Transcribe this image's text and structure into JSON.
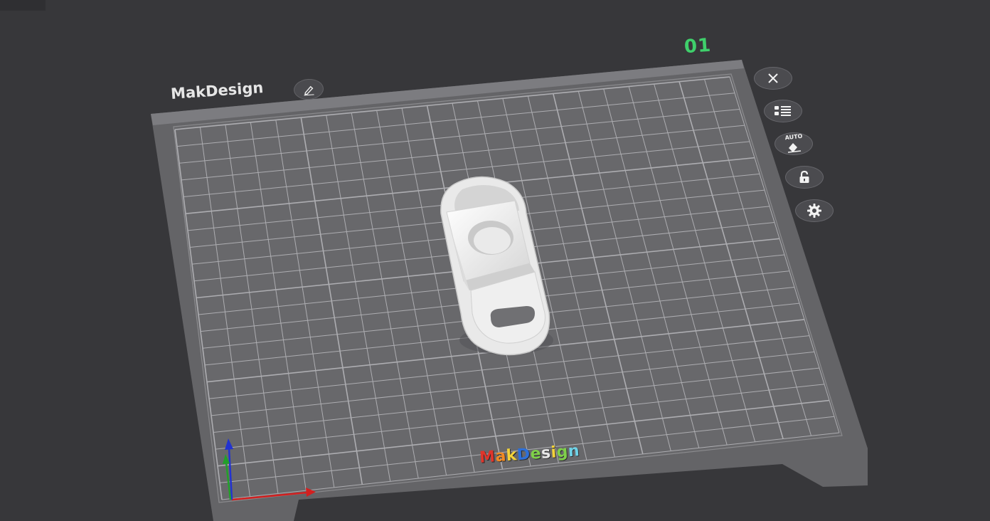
{
  "plate": {
    "number": "01",
    "name": "MakDesign"
  },
  "toolbar": {
    "auto_label": "AUTO"
  },
  "brand": {
    "letters": [
      "M",
      "a",
      "k",
      "D",
      "e",
      "s",
      "i",
      "g",
      "n"
    ],
    "letter_colors": [
      "#e0352b",
      "#f08a24",
      "#f3d33a",
      "#2d6fd8",
      "#7fd04a",
      "#e8e8e8",
      "#f3d33a",
      "#7fd04a",
      "#6fd3e8"
    ]
  },
  "colors": {
    "background": "#37373a",
    "plate": "#6d6d70",
    "grid_line": "#a9a9ad",
    "plate_number": "#3fcf6b",
    "model": "#f2f2f2",
    "axis_x": "#d22020",
    "axis_y": "#22a02a",
    "axis_z": "#2233d0"
  },
  "icons": {
    "close": "close-icon",
    "list": "object-list-icon",
    "auto": "auto-arrange-icon",
    "lock": "lock-icon",
    "settings": "gear-icon",
    "edit": "pencil-icon"
  }
}
